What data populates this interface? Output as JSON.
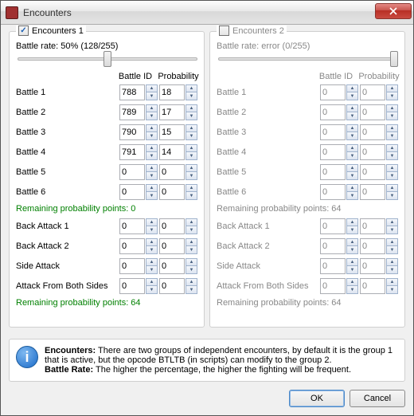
{
  "window": {
    "title": "Encounters",
    "close_aria": "Close"
  },
  "groups": [
    {
      "key": "g1",
      "label": "Encounters 1",
      "checked": true,
      "enabled": true,
      "rate_text": "Battle rate: 50% (128/255)",
      "slider_pos_pct": 50,
      "col_id": "Battle ID",
      "col_prob": "Probability",
      "battles": [
        {
          "label": "Battle 1",
          "id": "788",
          "prob": "18"
        },
        {
          "label": "Battle 2",
          "id": "789",
          "prob": "17"
        },
        {
          "label": "Battle 3",
          "id": "790",
          "prob": "15"
        },
        {
          "label": "Battle 4",
          "id": "791",
          "prob": "14"
        },
        {
          "label": "Battle 5",
          "id": "0",
          "prob": "0"
        },
        {
          "label": "Battle 6",
          "id": "0",
          "prob": "0"
        }
      ],
      "remaining_battles": "Remaining probability points: 0",
      "specials": [
        {
          "label": "Back Attack 1",
          "id": "0",
          "prob": "0"
        },
        {
          "label": "Back Attack 2",
          "id": "0",
          "prob": "0"
        },
        {
          "label": "Side Attack",
          "id": "0",
          "prob": "0"
        },
        {
          "label": "Attack From Both Sides",
          "id": "0",
          "prob": "0"
        }
      ],
      "remaining_specials": "Remaining probability points: 64"
    },
    {
      "key": "g2",
      "label": "Encounters 2",
      "checked": false,
      "enabled": false,
      "rate_text": "Battle rate: error (0/255)",
      "slider_pos_pct": 98,
      "col_id": "Battle ID",
      "col_prob": "Probability",
      "battles": [
        {
          "label": "Battle 1",
          "id": "0",
          "prob": "0"
        },
        {
          "label": "Battle 2",
          "id": "0",
          "prob": "0"
        },
        {
          "label": "Battle 3",
          "id": "0",
          "prob": "0"
        },
        {
          "label": "Battle 4",
          "id": "0",
          "prob": "0"
        },
        {
          "label": "Battle 5",
          "id": "0",
          "prob": "0"
        },
        {
          "label": "Battle 6",
          "id": "0",
          "prob": "0"
        }
      ],
      "remaining_battles": "Remaining probability points: 64",
      "specials": [
        {
          "label": "Back Attack 1",
          "id": "0",
          "prob": "0"
        },
        {
          "label": "Back Attack 2",
          "id": "0",
          "prob": "0"
        },
        {
          "label": "Side Attack",
          "id": "0",
          "prob": "0"
        },
        {
          "label": "Attack From Both Sides",
          "id": "0",
          "prob": "0"
        }
      ],
      "remaining_specials": "Remaining probability points: 64"
    }
  ],
  "info": {
    "line1a": "Encounters:",
    "line1b": " There are two groups of independent encounters, by default it is the group 1 that is active, but the opcode BTLTB (in scripts) can modify to the group 2.",
    "line2a": "Battle Rate:",
    "line2b": " The higher the percentage, the higher the fighting will be frequent."
  },
  "buttons": {
    "ok": "OK",
    "cancel": "Cancel"
  }
}
